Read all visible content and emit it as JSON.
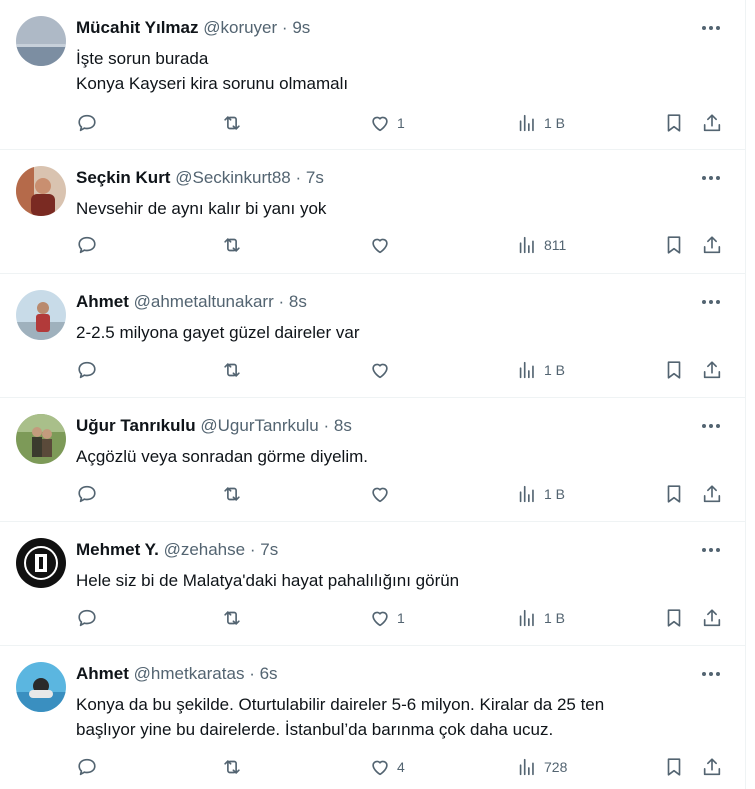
{
  "tweets": [
    {
      "name": "Mücahit Yılmaz",
      "handle": "@koruyer",
      "time": "9s",
      "lines": [
        "İşte sorun burada",
        "Konya Kayseri kira sorunu olmamalı"
      ],
      "likes": "1",
      "views": "1 B",
      "avatar_colors": [
        "#9aa8b8",
        "#6b7d90"
      ]
    },
    {
      "name": "Seçkin Kurt",
      "handle": "@Seckinkurt88",
      "time": "7s",
      "lines": [
        "Nevsehir de aynı kalır bi yanı yok"
      ],
      "likes": "",
      "views": "811",
      "avatar_colors": [
        "#c9a38a",
        "#8a3a2c"
      ]
    },
    {
      "name": "Ahmet",
      "handle": "@ahmetaltunakarr",
      "time": "8s",
      "lines": [
        "2-2.5 milyona gayet güzel daireler var"
      ],
      "likes": "",
      "views": "1 B",
      "avatar_colors": [
        "#b8cfe0",
        "#a84040"
      ]
    },
    {
      "name": "Uğur Tanrıkulu",
      "handle": "@UgurTanrkulu",
      "time": "8s",
      "lines": [
        "Açgözlü veya sonradan görme diyelim."
      ],
      "likes": "",
      "views": "1 B",
      "avatar_colors": [
        "#6f8a4c",
        "#3a4a2a"
      ]
    },
    {
      "name": "Mehmet Y.",
      "handle": "@zehahse",
      "time": "7s",
      "lines": [
        "Hele siz bi de Malatya'daki hayat pahalılığını görün"
      ],
      "likes": "1",
      "views": "1 B",
      "avatar_colors": [
        "#111111",
        "#ffffff"
      ]
    },
    {
      "name": "Ahmet",
      "handle": "@hmetkaratas",
      "time": "6s",
      "lines": [
        "Konya da bu şekilde. Oturtulabilir daireler 5-6 milyon. Kiralar da 25 ten",
        "başlıyor yine bu dairelerde. İstanbul’da barınma çok daha ucuz."
      ],
      "likes": "4",
      "views": "728",
      "avatar_colors": [
        "#4aa8d8",
        "#2a2a2a"
      ]
    }
  ],
  "separator": "·"
}
